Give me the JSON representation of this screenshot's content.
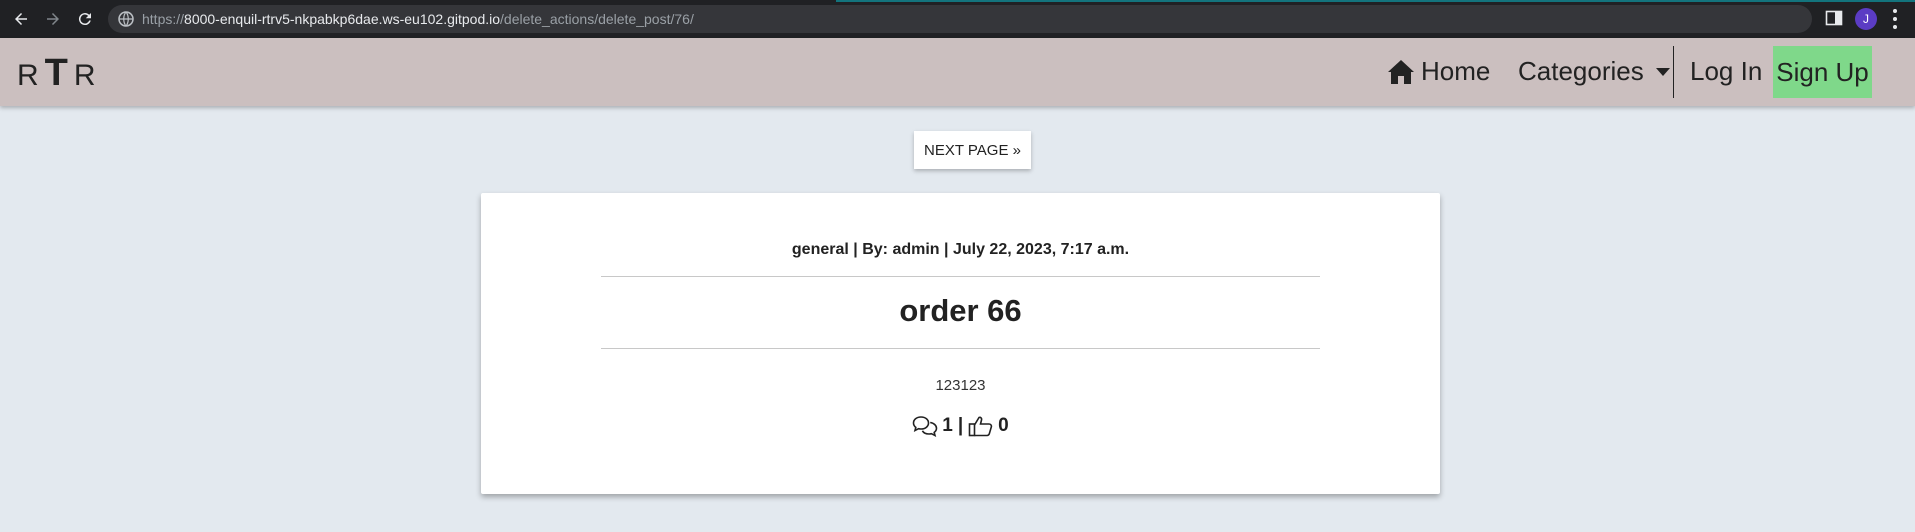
{
  "browser": {
    "url_scheme": "https://",
    "url_host": "8000-enquil-rtrv5-nkpabkp6dae.ws-eu102.gitpod.io",
    "url_path": "/delete_actions/delete_post/76/",
    "avatar_initial": "J",
    "icons": [
      "back-arrow-icon",
      "forward-arrow-icon",
      "reload-icon",
      "site-info-icon",
      "side-panel-icon",
      "menu-dots-icon"
    ]
  },
  "navbar": {
    "brand": {
      "left": "R",
      "middle": "T",
      "right": "R"
    },
    "home_label": "Home",
    "categories_label": "Categories",
    "login_label": "Log In",
    "signup_label": "Sign Up",
    "signup_color": "#7fd88a",
    "background": "#cbbfbf"
  },
  "pagination": {
    "next_label": "NEXT PAGE »"
  },
  "post": {
    "category": "general",
    "separator": "|",
    "author_prefix": "By:",
    "author": "admin",
    "date": "July 22, 2023, 7:17 a.m.",
    "title": "order 66",
    "content": "123123",
    "comments_count": "1",
    "likes_count": "0"
  }
}
